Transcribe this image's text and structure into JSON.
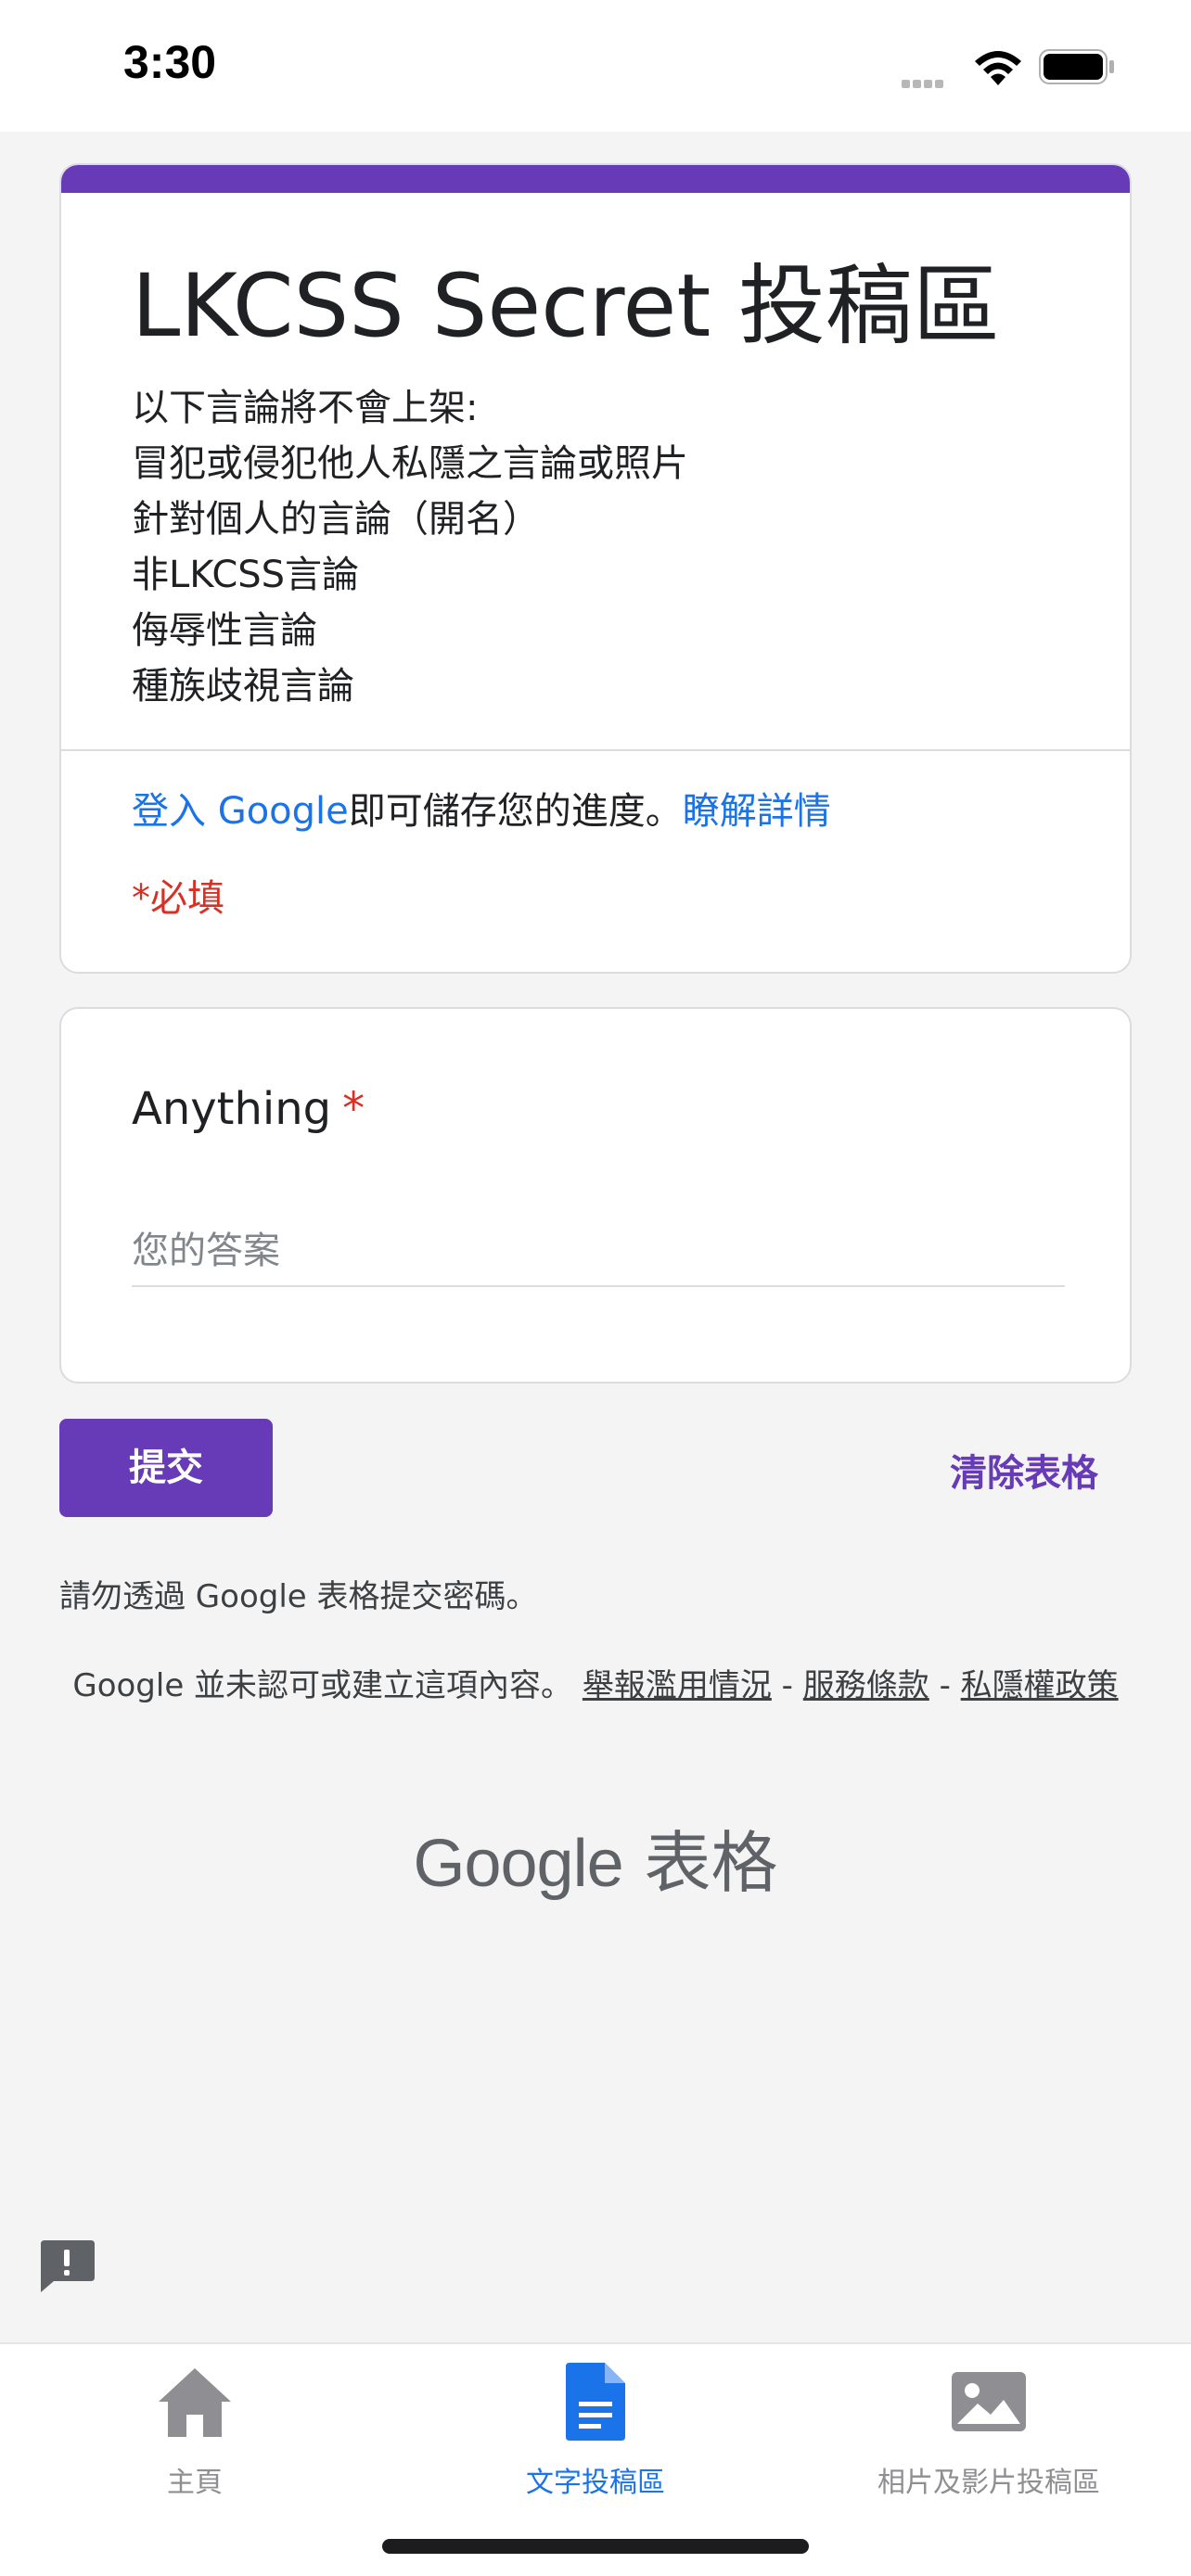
{
  "status_bar": {
    "time": "3:30"
  },
  "form": {
    "title": "LKCSS Secret 投稿區",
    "description_lines": [
      "以下言論將不會上架:",
      "冒犯或侵犯他人私隱之言論或照片",
      "針對個人的言論（開名）",
      "非LKCSS言論",
      "侮辱性言論",
      "種族歧視言論"
    ],
    "signin_link": "登入 Google",
    "signin_text": "即可儲存您的進度。",
    "learn_more": "瞭解詳情",
    "required_note": "*必填"
  },
  "question": {
    "title": "Anything",
    "required_mark": "*",
    "placeholder": "您的答案"
  },
  "actions": {
    "submit": "提交",
    "clear": "清除表格"
  },
  "password_note": "請勿透過 Google 表格提交密碼。",
  "footer": {
    "text": "Google 並未認可或建立這項內容。",
    "report": "舉報濫用情況",
    "sep1": " - ",
    "terms": "服務條款",
    "sep2": " - ",
    "privacy": "私隱權政策"
  },
  "brand": {
    "google": "Google",
    "forms": "表格"
  },
  "tabbar": {
    "tabs": [
      {
        "label": "主頁",
        "icon": "home-icon",
        "active": false
      },
      {
        "label": "文字投稿區",
        "icon": "document-icon",
        "active": true
      },
      {
        "label": "相片及影片投稿區",
        "icon": "image-icon",
        "active": false
      }
    ]
  },
  "colors": {
    "accent": "#673ab7",
    "link": "#1a73e8",
    "required": "#d93025",
    "active_tab": "#1a73e8"
  }
}
